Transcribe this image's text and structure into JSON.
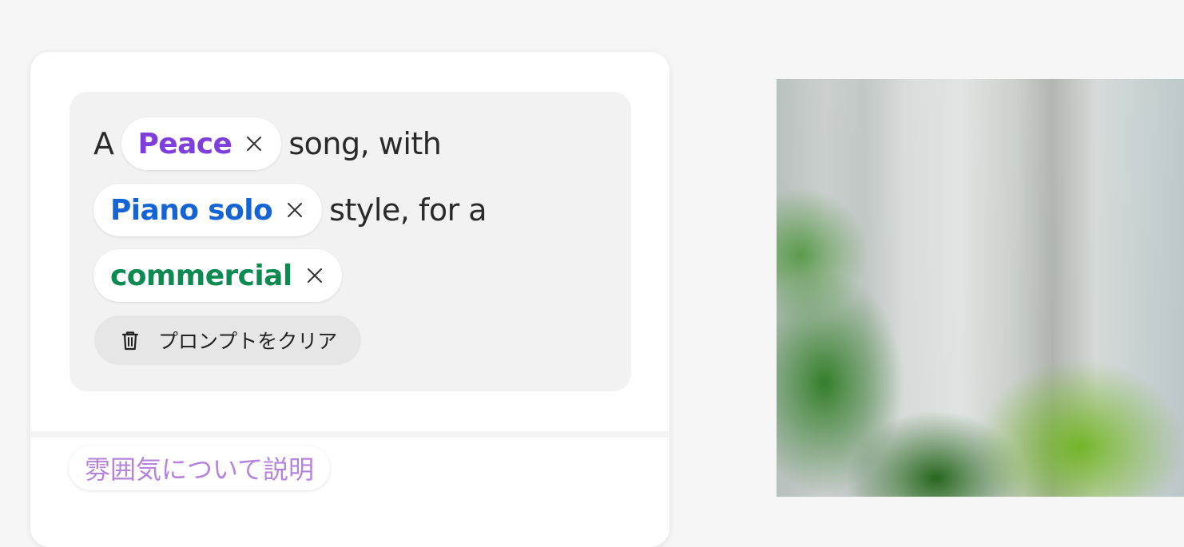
{
  "prompt": {
    "line1_prefix": "A",
    "mood_tag": "Peace",
    "line1_suffix": "song, with",
    "genre_tag": "Piano solo",
    "line2_suffix": "style, for a",
    "purpose_tag": "commercial",
    "close_glyph": "×"
  },
  "actions": {
    "clear_prompt_label": "プロンプトをクリア"
  },
  "suggestion": {
    "describe_mood_label": "雰囲気について説明"
  },
  "colors": {
    "mood": "#7f3fdc",
    "genre": "#1564d6",
    "purpose": "#0d8a52",
    "suggestion_text": "#b483dd"
  },
  "icons": [
    "close-icon",
    "trash-icon"
  ]
}
